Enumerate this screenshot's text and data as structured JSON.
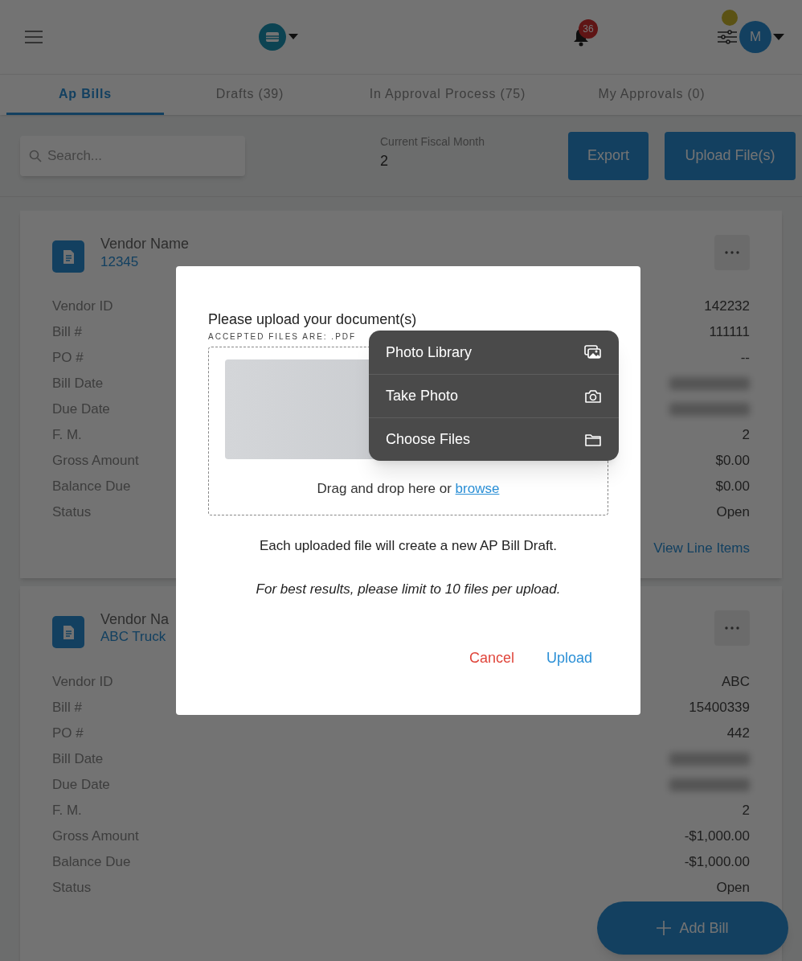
{
  "header": {
    "notification_count": "36",
    "avatar_initial": "M"
  },
  "tabs": [
    {
      "label": "Ap Bills",
      "selected": true
    },
    {
      "label": "Drafts (39)",
      "selected": false
    },
    {
      "label": "In Approval Process (75)",
      "selected": false
    },
    {
      "label": "My Approvals (0)",
      "selected": false
    }
  ],
  "search": {
    "placeholder": "Search..."
  },
  "fiscal_month": {
    "label": "Current Fiscal Month",
    "value": "2"
  },
  "toolbar_buttons": [
    "Export",
    "Upload File(s)"
  ],
  "bills": [
    {
      "vendor_label": "Vendor Name",
      "vendor_value": "12345",
      "fields": [
        {
          "label": "Vendor ID",
          "value": "142232"
        },
        {
          "label": "Bill #",
          "value": "111111"
        },
        {
          "label": "PO #",
          "value": "--"
        },
        {
          "label": "Bill Date",
          "kind": "redacted"
        },
        {
          "label": "Due Date",
          "kind": "redacted"
        },
        {
          "label": "F. M.",
          "value": "2"
        },
        {
          "label": "Gross Amount",
          "value": "$0.00"
        },
        {
          "label": "Balance Due",
          "value": "$0.00"
        },
        {
          "label": "Status",
          "value": "Open"
        }
      ],
      "link": "View Line Items"
    },
    {
      "vendor_label": "Vendor Na",
      "vendor_value": "ABC Truck",
      "fields": [
        {
          "label": "Vendor ID",
          "value": "ABC"
        },
        {
          "label": "Bill #",
          "value": "15400339"
        },
        {
          "label": "PO #",
          "value": "442"
        },
        {
          "label": "Bill Date",
          "kind": "redacted"
        },
        {
          "label": "Due Date",
          "kind": "redacted"
        },
        {
          "label": "F. M.",
          "value": "2"
        },
        {
          "label": "Gross Amount",
          "value": "-$1,000.00"
        },
        {
          "label": "Balance Due",
          "value": "-$1,000.00"
        },
        {
          "label": "Status",
          "value": "Open"
        }
      ]
    }
  ],
  "add_button": "Add Bill",
  "upload_dialog": {
    "title": "Please upload your document(s)",
    "accepted": "ACCEPTED FILES ARE: .PDF",
    "drop_text": "Drag and drop here or",
    "browse_link": "browse",
    "info": "Each uploaded file will create a new AP Bill Draft.",
    "note": "For best results, please limit to 10 files per upload.",
    "cancel": "Cancel",
    "upload": "Upload"
  },
  "file_menu": [
    {
      "label": "Photo Library"
    },
    {
      "label": "Take Photo"
    },
    {
      "label": "Choose Files"
    }
  ]
}
